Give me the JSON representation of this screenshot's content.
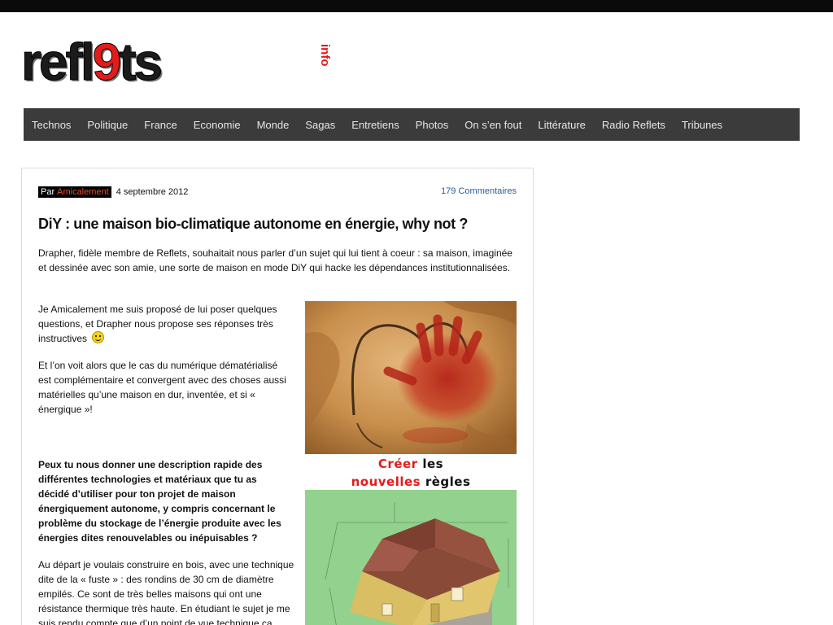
{
  "logo": {
    "word_a": "refl",
    "word_b": "9",
    "word_c": "ts",
    "suffix": "info"
  },
  "nav": {
    "items": [
      "Technos",
      "Politique",
      "France",
      "Economie",
      "Monde",
      "Sagas",
      "Entretiens",
      "Photos",
      "On s’en fout",
      "Littérature",
      "Radio Reflets",
      "Tribunes"
    ]
  },
  "post": {
    "meta": {
      "by_label": "Par",
      "author": "Amicalement",
      "date": "4 septembre 2012",
      "comments": "179 Commentaires"
    },
    "title": "DiY : une maison bio-climatique autonome en énergie, why not ?",
    "intro": "Drapher, fidèle membre de Reflets, souhaitait nous parler d’un sujet qui lui tient à coeur : sa maison, imaginée et dessinée avec son amie, une sorte de maison en mode DiY qui hacke les dépendances institutionnalisées.",
    "p2": "Je Amicalement me suis proposé de lui poser quelques questions, et Drapher nous propose ses réponses très instructives",
    "p3": "Et l’on voit alors que le cas du numérique dématérialisé est complémentaire et convergent avec des choses aussi matérielles qu’une maison en dur, inventée, et si « énergique »!",
    "question": "Peux tu nous donner une description rapide des différentes technologies et matériaux que tu as décidé d’utiliser pour ton projet de maison énergiquement autonome, y compris concernant le problème du stockage de l’énergie produite avec les énergies dites renouvelables ou inépuisables ?",
    "p4": "Au départ je voulais construire en bois, avec une technique dite de la « fuste » : des rondins de 30 cm de diamètre empilés. Ce sont de très belles maisons qui ont une résistance thermique très haute. En étudiant le sujet je me suis rendu compte que d’un point de vue technique ça",
    "caption": {
      "w1": "Créer",
      "w2": "les",
      "w3": "nouvelles",
      "w4": "règles"
    }
  }
}
